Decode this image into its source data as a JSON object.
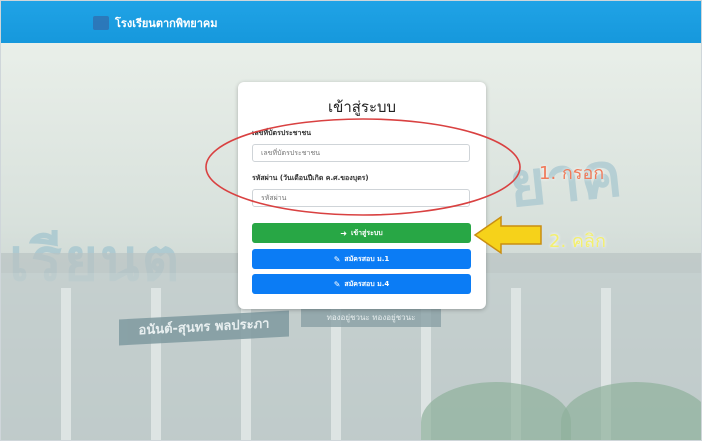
{
  "header": {
    "brand": "โรงเรียนตากพิทยาคม"
  },
  "background": {
    "sign_text": "เรียนต",
    "sign_text_right": "ยาค",
    "plate_text": "อนันต์-สุนทร พลประภา",
    "plate_small": "ทองอยู่ชวนะ ทองอยู่ชวนะ"
  },
  "login": {
    "title": "เข้าสู่ระบบ",
    "id_label": "เลขที่บัตรประชาชน",
    "id_placeholder": "เลขที่บัตรประชาชน",
    "pw_label": "รหัสผ่าน (วันเดือนปีเกิด ค.ศ.ของบุตร)",
    "pw_placeholder": "รหัสผ่าน",
    "login_button": "เข้าสู่ระบบ",
    "register_m1": "สมัครสอบ ม.1",
    "register_m4": "สมัครสอบ ม.4"
  },
  "annotations": {
    "step1": "1. กรอก",
    "step2": "2. คลิก"
  },
  "colors": {
    "navbar": "#1a9ee1",
    "login_btn": "#28a745",
    "register_btn": "#0b7cf5",
    "ellipse": "#d94141",
    "arrow": "#f6d21a"
  },
  "icons": {
    "login": "sign-in-icon",
    "register": "edit-icon",
    "brand": "school-logo-icon"
  }
}
